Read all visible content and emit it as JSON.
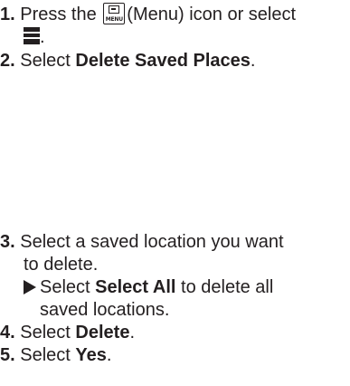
{
  "steps": {
    "s1": {
      "num": "1.",
      "pre": "Press the",
      "icon_label": "MENU",
      "post": "(Menu) icon or select",
      "end": "."
    },
    "s2": {
      "num": "2.",
      "pre": "Select",
      "bold": "Delete Saved Places",
      "end": "."
    },
    "s3": {
      "num": "3.",
      "line1": "Select a saved location you want",
      "line2": "to delete."
    },
    "tip": {
      "pre": "Select",
      "bold": "Select All",
      "line1_post": "to delete all",
      "line2": "saved locations."
    },
    "s4": {
      "num": "4.",
      "pre": "Select",
      "bold": "Delete",
      "end": "."
    },
    "s5": {
      "num": "5.",
      "pre": "Select",
      "bold": "Yes",
      "end": "."
    }
  },
  "icons": {
    "menu": "menu-button-icon",
    "list": "list-menu-icon",
    "arrow": "triangle-bullet-icon"
  }
}
